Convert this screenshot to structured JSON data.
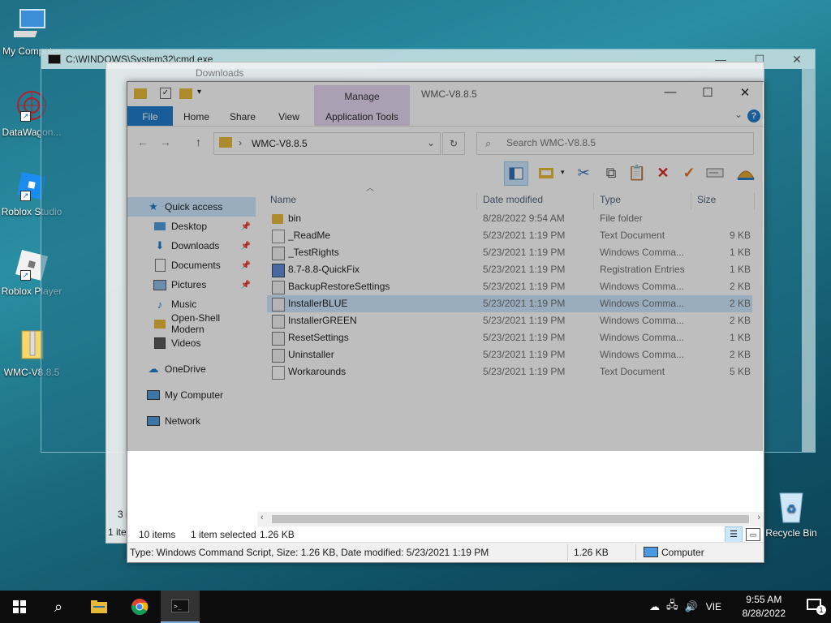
{
  "desktop": {
    "icons": [
      {
        "label": "My Computer"
      },
      {
        "label": "DataWagon..."
      },
      {
        "label": "Roblox Studio"
      },
      {
        "label": "Roblox Player"
      },
      {
        "label": "WMC-V8.8.5"
      }
    ],
    "recycle_bin": "Recycle Bin"
  },
  "cmd_window": {
    "title": "C:\\WINDOWS\\System32\\cmd.exe"
  },
  "downloads_window": {
    "title": "Downloads",
    "status_items": "3 i",
    "status_item": "1 ite"
  },
  "explorer": {
    "title": "WMC-V8.8.5",
    "manage_tab": "Manage",
    "ribbon_tabs": {
      "file": "File",
      "home": "Home",
      "share": "Share",
      "view": "View",
      "app_tools": "Application Tools"
    },
    "address": {
      "path": "WMC-V8.8.5"
    },
    "search": {
      "placeholder": "Search WMC-V8.8.5"
    },
    "nav": [
      {
        "label": "Quick access"
      },
      {
        "label": "Desktop"
      },
      {
        "label": "Downloads"
      },
      {
        "label": "Documents"
      },
      {
        "label": "Pictures"
      },
      {
        "label": "Music"
      },
      {
        "label": "Open-Shell Modern"
      },
      {
        "label": "Videos"
      },
      {
        "label": "OneDrive"
      },
      {
        "label": "My Computer"
      },
      {
        "label": "Network"
      }
    ],
    "columns": {
      "name": "Name",
      "date": "Date modified",
      "type": "Type",
      "size": "Size"
    },
    "files": [
      {
        "name": "bin",
        "date": "8/28/2022 9:54 AM",
        "type": "File folder",
        "size": "",
        "icon": "folder-icon"
      },
      {
        "name": "_ReadMe",
        "date": "5/23/2021 1:19 PM",
        "type": "Text Document",
        "size": "9 KB",
        "icon": "text-file-icon"
      },
      {
        "name": "_TestRights",
        "date": "5/23/2021 1:19 PM",
        "type": "Windows Comma...",
        "size": "1 KB",
        "icon": "script-file-icon"
      },
      {
        "name": "8.7-8.8-QuickFix",
        "date": "5/23/2021 1:19 PM",
        "type": "Registration Entries",
        "size": "1 KB",
        "icon": "registry-file-icon"
      },
      {
        "name": "BackupRestoreSettings",
        "date": "5/23/2021 1:19 PM",
        "type": "Windows Comma...",
        "size": "2 KB",
        "icon": "script-file-icon"
      },
      {
        "name": "InstallerBLUE",
        "date": "5/23/2021 1:19 PM",
        "type": "Windows Comma...",
        "size": "2 KB",
        "icon": "script-file-icon"
      },
      {
        "name": "InstallerGREEN",
        "date": "5/23/2021 1:19 PM",
        "type": "Windows Comma...",
        "size": "2 KB",
        "icon": "script-file-icon"
      },
      {
        "name": "ResetSettings",
        "date": "5/23/2021 1:19 PM",
        "type": "Windows Comma...",
        "size": "1 KB",
        "icon": "script-file-icon"
      },
      {
        "name": "Uninstaller",
        "date": "5/23/2021 1:19 PM",
        "type": "Windows Comma...",
        "size": "2 KB",
        "icon": "script-file-icon"
      },
      {
        "name": "Workarounds",
        "date": "5/23/2021 1:19 PM",
        "type": "Text Document",
        "size": "5 KB",
        "icon": "text-file-icon"
      }
    ],
    "status": {
      "count": "10 items",
      "selected": "1 item selected",
      "selected_size": "1.26 KB"
    },
    "details_bar": {
      "info": "Type: Windows Command Script, Size: 1.26 KB, Date modified: 5/23/2021 1:19 PM",
      "size": "1.26 KB",
      "location": "Computer"
    }
  },
  "taskbar": {
    "language": "VIE",
    "time": "9:55 AM",
    "date": "8/28/2022",
    "notification_count": "1"
  },
  "colors": {
    "accent": "#1979ca",
    "selection": "#cce8ff",
    "manage": "#e4d4f0"
  }
}
